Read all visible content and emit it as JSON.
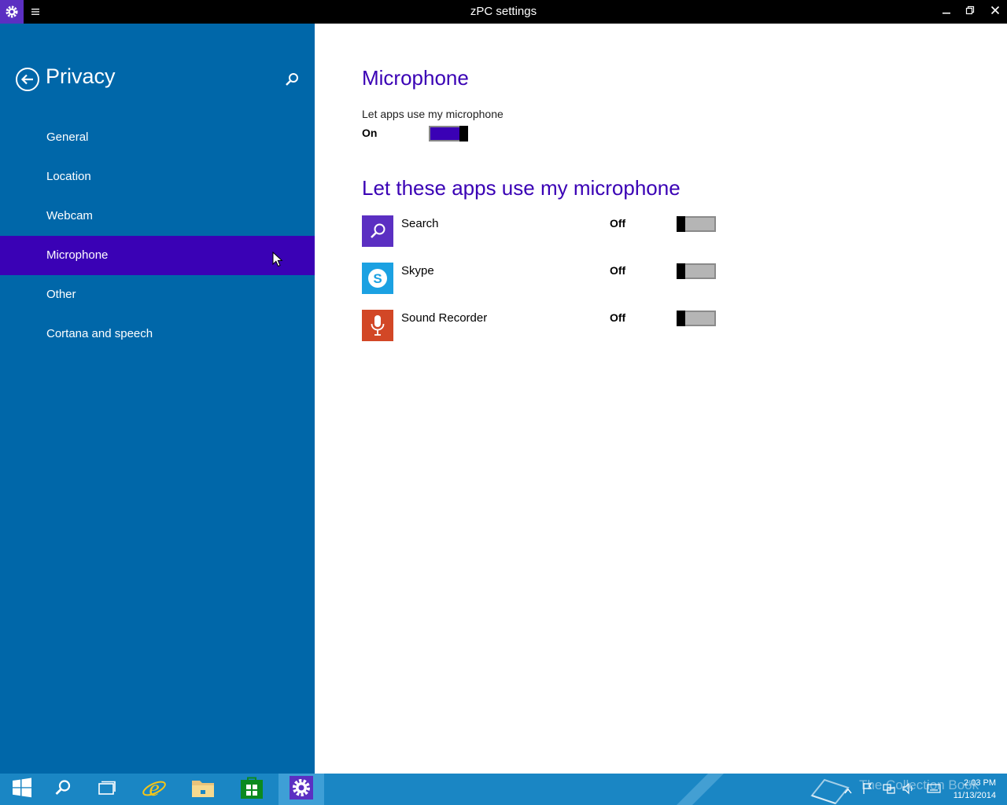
{
  "window": {
    "title": "zPC settings",
    "icons": [
      "settings-gear-icon",
      "hamburger-menu-icon",
      "minimize-icon",
      "restore-icon",
      "close-icon"
    ]
  },
  "sidebar": {
    "heading": "Privacy",
    "items": [
      {
        "label": "General"
      },
      {
        "label": "Location"
      },
      {
        "label": "Webcam"
      },
      {
        "label": "Microphone",
        "selected": true
      },
      {
        "label": "Other"
      },
      {
        "label": "Cortana and speech"
      }
    ]
  },
  "main": {
    "title": "Microphone",
    "master_toggle": {
      "label": "Let apps use my microphone",
      "state": "On",
      "on": true
    },
    "apps_heading": "Let these apps use my microphone",
    "apps": [
      {
        "name": "Search",
        "state": "Off",
        "on": false,
        "icon": "search-icon",
        "icon_bg": "#5b2fc2"
      },
      {
        "name": "Skype",
        "state": "Off",
        "on": false,
        "icon": "skype-icon",
        "icon_bg": "#1ba1e2"
      },
      {
        "name": "Sound Recorder",
        "state": "Off",
        "on": false,
        "icon": "microphone-icon",
        "icon_bg": "#d24726"
      }
    ]
  },
  "taskbar": {
    "items": [
      "start-icon",
      "search-icon",
      "task-view-icon",
      "internet-explorer-icon",
      "file-explorer-icon",
      "store-icon",
      "settings-icon"
    ],
    "time": "2:03 PM",
    "date": "11/13/2014",
    "watermark": "The Collection Book"
  },
  "colors": {
    "accent": "#3a01b5",
    "sidebar_bg": "#0067a9",
    "taskbar_bg": "#1a86c4"
  }
}
